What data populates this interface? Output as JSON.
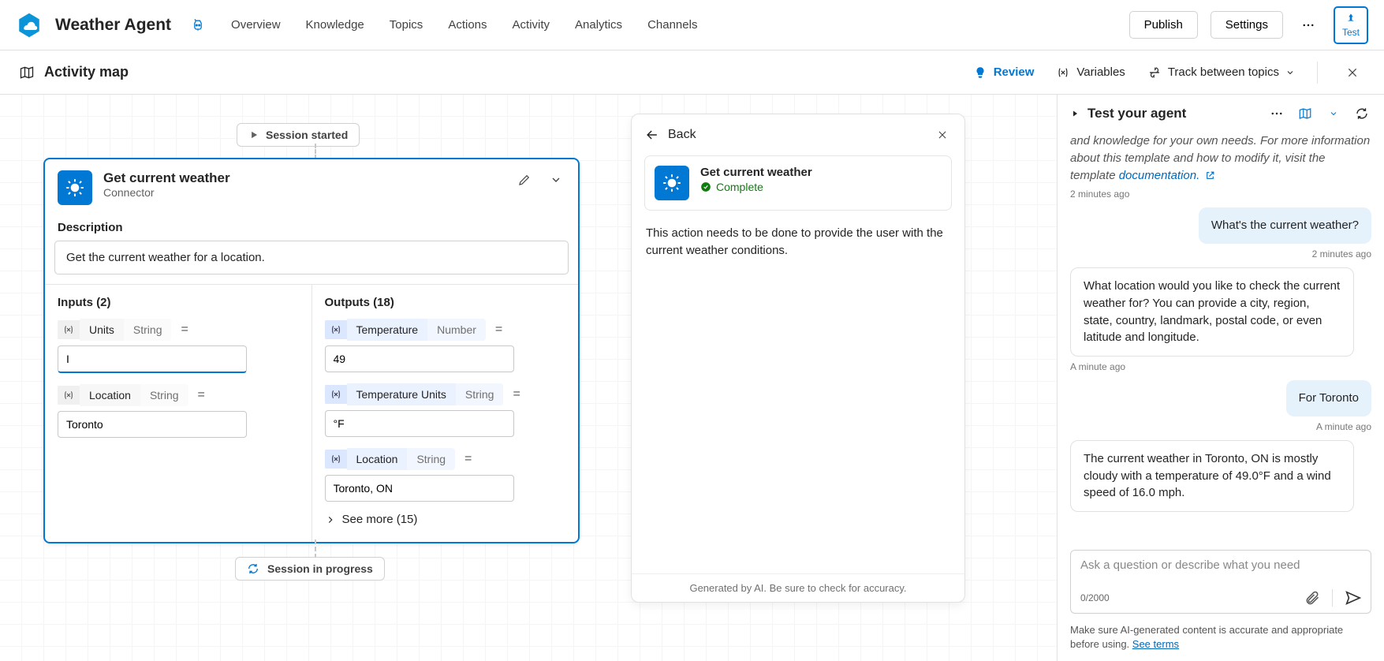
{
  "app": {
    "title": "Weather Agent"
  },
  "nav": {
    "tabs": [
      "Overview",
      "Knowledge",
      "Topics",
      "Actions",
      "Activity",
      "Analytics",
      "Channels"
    ],
    "publish": "Publish",
    "settings": "Settings",
    "test": "Test"
  },
  "secondbar": {
    "title": "Activity map",
    "review": "Review",
    "variables": "Variables",
    "track": "Track between topics"
  },
  "canvas": {
    "session_started": "Session started",
    "session_progress": "Session in progress",
    "node": {
      "title": "Get current weather",
      "subtitle": "Connector",
      "desc_label": "Description",
      "desc": "Get the current weather for a location.",
      "inputs_heading": "Inputs (2)",
      "outputs_heading": "Outputs (18)",
      "inputs": [
        {
          "name": "Units",
          "type": "String",
          "value": "I"
        },
        {
          "name": "Location",
          "type": "String",
          "value": "Toronto"
        }
      ],
      "outputs": [
        {
          "name": "Temperature",
          "type": "Number",
          "value": "49"
        },
        {
          "name": "Temperature Units",
          "type": "String",
          "value": "°F"
        },
        {
          "name": "Location",
          "type": "String",
          "value": "Toronto, ON"
        }
      ],
      "see_more": "See more (15)"
    }
  },
  "detail": {
    "back": "Back",
    "title": "Get current weather",
    "status": "Complete",
    "body": "This action needs to be done to provide the user with the current weather conditions.",
    "footer": "Generated by AI. Be sure to check for accuracy."
  },
  "test": {
    "title": "Test your agent",
    "intro_tail_1": "and knowledge for your own needs. For more information about this template and how to modify it, visit the template ",
    "intro_link": "documentation.",
    "ts1": "2 minutes ago",
    "user1": "What's the current weather?",
    "ts2": "2 minutes ago",
    "agent1": "What location would you like to check the current weather for? You can provide a city, region, state, country, landmark, postal code, or even latitude and longitude.",
    "ts3": "A minute ago",
    "user2": "For Toronto",
    "ts4": "A minute ago",
    "agent2": "The current weather in Toronto, ON is mostly cloudy with a temperature of 49.0°F and a wind speed of 16.0 mph.",
    "placeholder": "Ask a question or describe what you need",
    "char_count": "0/2000",
    "disclaimer_1": "Make sure AI-generated content is accurate and appropriate before using. ",
    "disclaimer_link": "See terms"
  }
}
